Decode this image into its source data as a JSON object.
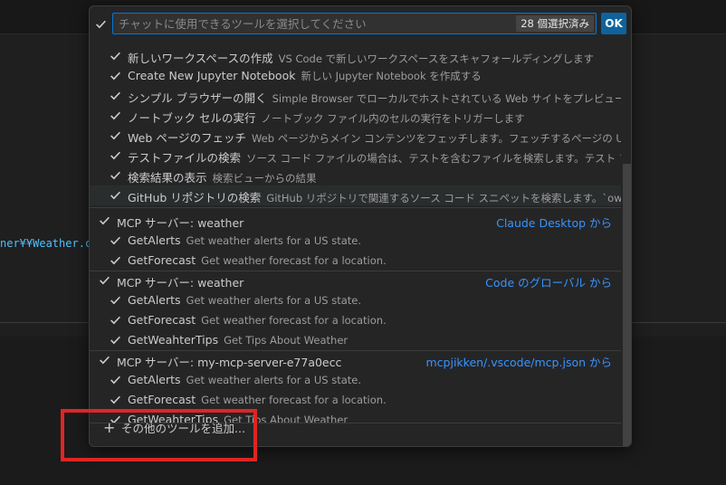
{
  "background": {
    "path_fragment": "ner¥¥Weather.cs"
  },
  "picker": {
    "search": {
      "placeholder": "チャットに使用できるツールを選択してください",
      "value": ""
    },
    "selected_count": "28 個選択済み",
    "ok_label": "OK",
    "groups_top": [
      {
        "name": "新しいワークスペースの作成",
        "desc": "VS Code で新しいワークスペースをスキャフォールディングします"
      },
      {
        "name": "Create New Jupyter Notebook",
        "desc": "新しい Jupyter Notebook を作成する"
      },
      {
        "name": "シンプル ブラウザーの開く",
        "desc": "Simple Browser でローカルでホストされている Web サイトをプレビューします"
      },
      {
        "name": "ノートブック セルの実行",
        "desc": "ノートブック ファイル内のセルの実行をトリガーします"
      },
      {
        "name": "Web ページのフェッチ",
        "desc": "Web ページからメイン コンテンツをフェッチします。フェッチするページの URL を含める必要があ..."
      },
      {
        "name": "テストファイルの検索",
        "desc": "ソース コード ファイルの場合は、テストを含むファイルを検索します。テスト ファイルの場合は、..."
      },
      {
        "name": "検索結果の表示",
        "desc": "検索ビューからの結果"
      },
      {
        "name": "GitHub リポジトリの検索",
        "desc": "GitHub リポジトリで関連するソース コード スニペットを検索します。`owner/repo` を..."
      }
    ],
    "servers": [
      {
        "title": "MCP サーバー: weather",
        "source": "Claude Desktop から",
        "tools": [
          {
            "name": "GetAlerts",
            "desc": "Get weather alerts for a US state."
          },
          {
            "name": "GetForecast",
            "desc": "Get weather forecast for a location."
          }
        ]
      },
      {
        "title": "MCP サーバー: weather",
        "source": "Code のグローバル から",
        "tools": [
          {
            "name": "GetAlerts",
            "desc": "Get weather alerts for a US state."
          },
          {
            "name": "GetForecast",
            "desc": "Get weather forecast for a location."
          },
          {
            "name": "GetWeahterTips",
            "desc": "Get Tips About Weather"
          }
        ]
      },
      {
        "title": "MCP サーバー: my-mcp-server-e77a0ecc",
        "source": "mcpjikken/.vscode/mcp.json から",
        "tools": [
          {
            "name": "GetAlerts",
            "desc": "Get weather alerts for a US state."
          },
          {
            "name": "GetForecast",
            "desc": "Get weather forecast for a location."
          },
          {
            "name": "GetWeahterTips",
            "desc": "Get Tips About Weather"
          }
        ]
      }
    ],
    "add_more_label": "その他のツールを追加...",
    "colors": {
      "accent": "#0078d4",
      "link": "#3794ff",
      "highlight_box": "#e02424"
    }
  }
}
